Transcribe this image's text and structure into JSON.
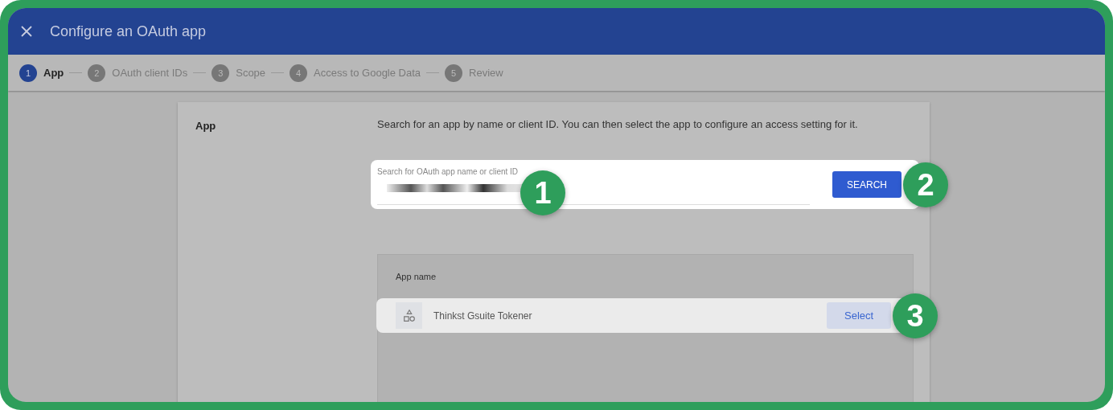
{
  "window": {
    "title": "Configure an OAuth app"
  },
  "steps": [
    {
      "number": "1",
      "label": "App",
      "selected": true
    },
    {
      "number": "2",
      "label": "OAuth client IDs",
      "selected": false
    },
    {
      "number": "3",
      "label": "Scope",
      "selected": false
    },
    {
      "number": "4",
      "label": "Access to Google Data",
      "selected": false
    },
    {
      "number": "5",
      "label": "Review",
      "selected": false
    }
  ],
  "section": {
    "title": "App",
    "description": "Search for an app by name or client ID. You can then select the app to configure an access setting for it."
  },
  "search": {
    "label": "Search for OAuth app name or client ID",
    "button": "SEARCH"
  },
  "table": {
    "columns": [
      "App name"
    ],
    "rows": [
      {
        "name": "Thinkst Gsuite Tokener",
        "action": "Select"
      }
    ]
  },
  "callouts": [
    "1",
    "2",
    "3"
  ]
}
